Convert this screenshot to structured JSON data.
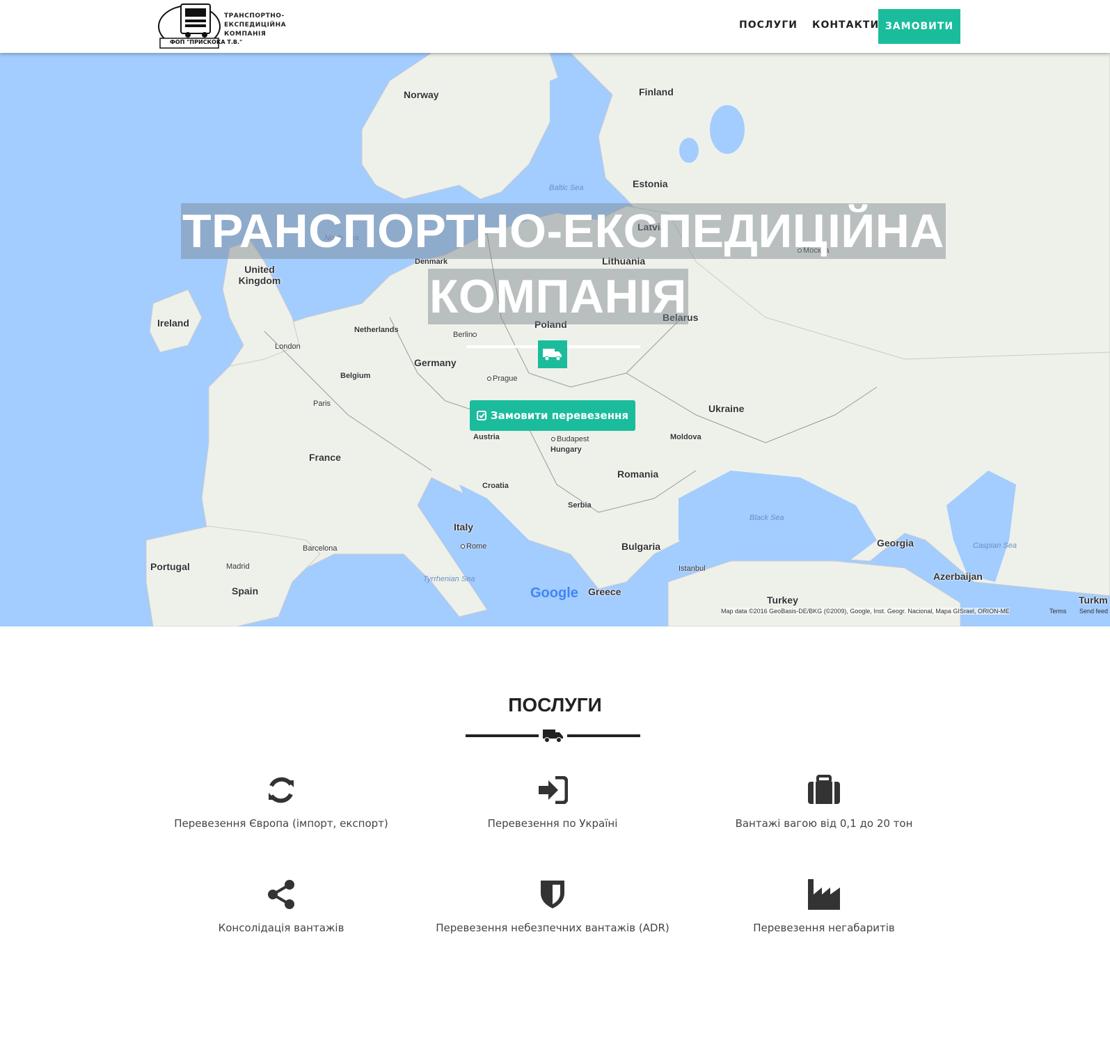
{
  "navbar": {
    "logo_lines": [
      "ТРАНСПОРТНО-",
      "ЕКСПЕДИЦІЙНА",
      "КОМПАНІЯ"
    ],
    "logo_badge": "ФОП \"ПРИСКОКА Т.В.\"",
    "links": [
      {
        "label": "ПОСЛУГИ"
      },
      {
        "label": "КОНТАКТИ"
      }
    ],
    "order_button": "ЗАМОВИТИ"
  },
  "hero": {
    "title_line1": "ТРАНСПОРТНО-ЕКСПЕДИЦІЙНА",
    "title_line2": "КОМПАНІЯ",
    "cta_button": "Замовити перевезення",
    "map": {
      "countries": [
        "Norway",
        "Finland",
        "Estonia",
        "Latvia",
        "Lithuania",
        "United Kingdom",
        "Ireland",
        "Denmark",
        "Netherlands",
        "Belarus",
        "Poland",
        "Germany",
        "Belgium",
        "Ukraine",
        "France",
        "Austria",
        "Hungary",
        "Moldova",
        "Romania",
        "Croatia",
        "Serbia",
        "Italy",
        "Bulgaria",
        "Portugal",
        "Spain",
        "Greece",
        "Turkey",
        "Georgia",
        "Azerbaijan",
        "Turkm"
      ],
      "cities": [
        "Москва",
        "Berlin",
        "London",
        "Prague",
        "Paris",
        "Budapest",
        "Barcelona",
        "Rome",
        "Madrid",
        "Istanbul"
      ],
      "seas": [
        "Baltic Sea",
        "North Sea",
        "Black Sea",
        "Caspian Sea",
        "Tyrrhenian Sea"
      ],
      "google": "Google",
      "attribution": "Map data ©2016 GeoBasis-DE/BKG (©2009), Google, Inst. Geogr. Nacional, Mapa GISrael, ORION-ME",
      "terms": "Terms",
      "feedback": "Send feed"
    }
  },
  "services": {
    "title": "ПОСЛУГИ",
    "items": [
      {
        "icon": "refresh-icon",
        "label": "Перевезення Європа (імпорт, експорт)"
      },
      {
        "icon": "sign-in-icon",
        "label": "Перевезення по Україні"
      },
      {
        "icon": "briefcase-icon",
        "label": "Вантажі вагою від 0,1 до 20 тон"
      },
      {
        "icon": "share-icon",
        "label": "Консолідація вантажів"
      },
      {
        "icon": "shield-icon",
        "label": "Перевезення небезпечних вантажів (ADR)"
      },
      {
        "icon": "industry-icon",
        "label": "Перевезення негабаритів"
      }
    ]
  },
  "colors": {
    "accent": "#1abc9c",
    "sea": "#a3ccff",
    "land": "#eef1ea",
    "dark": "#222222"
  }
}
